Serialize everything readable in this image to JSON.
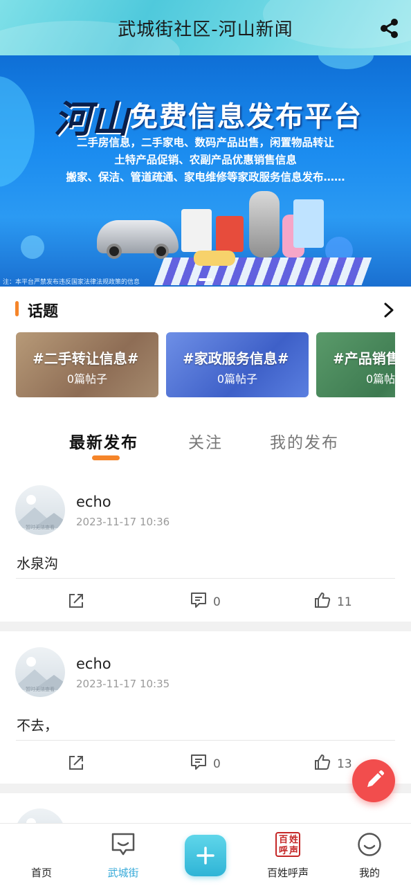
{
  "header": {
    "title": "武城街社区-河山新闻",
    "share_icon": "share-icon"
  },
  "banner": {
    "logo": "河山",
    "headline": "免费信息发布平台",
    "lines": [
      "二手房信息，二手家电、数码产品出售，闲置物品转让",
      "土特产品促销、农副产品优惠销售信息",
      "搬家、保洁、管道疏通、家电维修等家政服务信息发布……"
    ],
    "note": "注：本平台严禁发布违反国家法律法规政策的信息"
  },
  "topics": {
    "title": "话题",
    "items": [
      {
        "name": "#二手转让信息#",
        "count": "0篇帖子"
      },
      {
        "name": "#家政服务信息#",
        "count": "0篇帖子"
      },
      {
        "name": "#产品销售",
        "count": "0篇帖"
      }
    ]
  },
  "tabs": [
    {
      "label": "最新发布",
      "active": true
    },
    {
      "label": "关注",
      "active": false
    },
    {
      "label": "我的发布",
      "active": false
    }
  ],
  "posts": [
    {
      "author": "echo",
      "time": "2023-11-17 10:36",
      "content": "水泉沟",
      "avatar_caption": "暂时无法查看",
      "comments": "0",
      "likes": "11"
    },
    {
      "author": "echo",
      "time": "2023-11-17 10:35",
      "content": "不去，",
      "avatar_caption": "暂时无法查看",
      "comments": "0",
      "likes": "13"
    }
  ],
  "bottom_nav": [
    {
      "label": "首页",
      "active": false
    },
    {
      "label": "武城街",
      "active": true
    },
    {
      "label": "",
      "icon": "plus-icon"
    },
    {
      "label": "百姓呼声",
      "active": false
    },
    {
      "label": "我的",
      "active": false
    }
  ],
  "seal_text": "百姓呼声",
  "colors": {
    "accent": "#f5852a",
    "fab": "#f24d4d",
    "nav_active": "#35a9d8",
    "header": "#4fc9dc",
    "banner": "#1a8bef"
  }
}
